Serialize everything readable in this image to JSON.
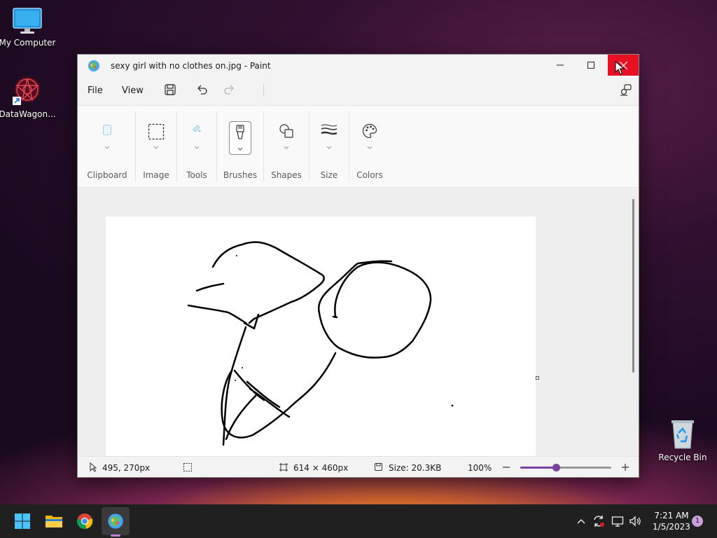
{
  "desktop": {
    "icons": [
      {
        "label": "My Computer"
      },
      {
        "label": "DataWagon..."
      },
      {
        "label": "Recycle Bin"
      }
    ]
  },
  "window": {
    "title": "sexy girl with no clothes on.jpg - Paint",
    "menu": {
      "file": "File",
      "view": "View"
    },
    "ribbon": {
      "groups": [
        "Clipboard",
        "Image",
        "Tools",
        "Brushes",
        "Shapes",
        "Size",
        "Colors"
      ]
    },
    "status": {
      "cursor_pos": "495, 270px",
      "canvas_size": "614 × 460px",
      "file_size": "Size: 20.3KB",
      "zoom": "100%",
      "zoom_fraction": 0.39
    }
  },
  "taskbar": {
    "time": "7:21 AM",
    "date": "1/5/2023",
    "notifications": "1"
  },
  "colors": {
    "accent": "#7b3fa0",
    "close_red": "#e81123",
    "taskbar": "#202020"
  }
}
